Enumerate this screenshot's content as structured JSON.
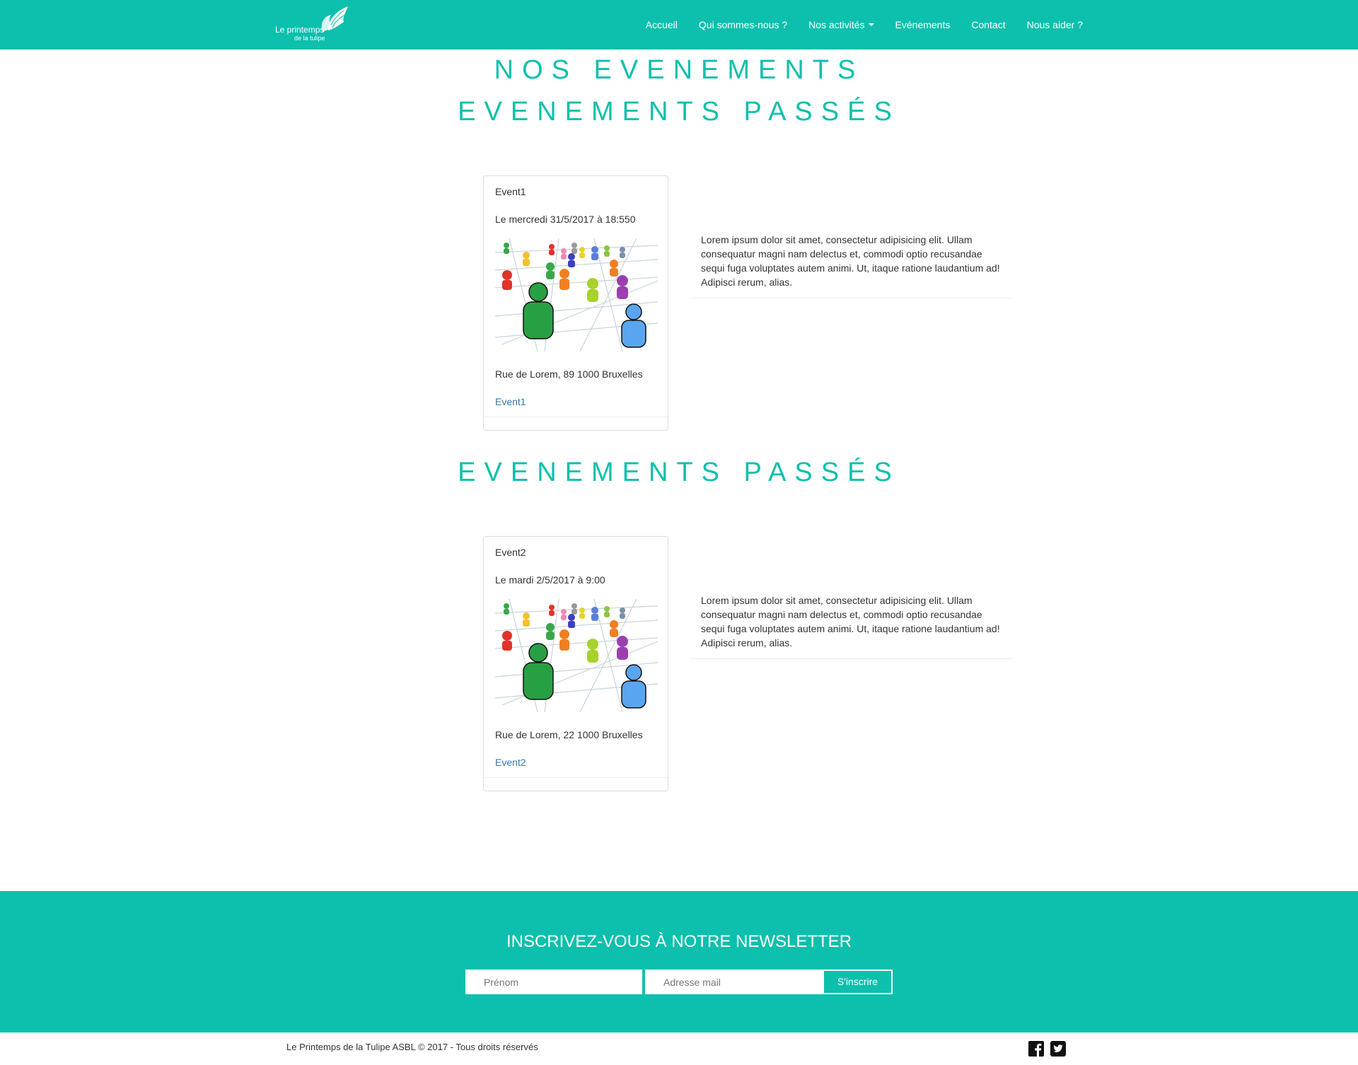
{
  "brand": {
    "line1": "Le printemps",
    "line2": "de la tulipe"
  },
  "nav": {
    "items": [
      {
        "label": "Accueil"
      },
      {
        "label": "Qui sommes-nous ?"
      },
      {
        "label": "Nos activités"
      },
      {
        "label": "Evénements"
      },
      {
        "label": "Contact"
      },
      {
        "label": "Nous aider ?"
      }
    ]
  },
  "page": {
    "title": "NOS EVENEMENTS",
    "sections": [
      {
        "heading": "EVENEMENTS PASSÉS",
        "event": {
          "title": "Event1",
          "date": "Le mercredi 31/5/2017 à 18:550",
          "address": "Rue de Lorem, 89 1000 Bruxelles",
          "link": "Event1",
          "description": "Lorem ipsum dolor sit amet, consectetur adipisicing elit. Ullam consequatur magni nam delectus et, commodi optio recusandae sequi fuga voluptates autem animi. Ut, itaque ratione laudantium ad! Adipisci rerum, alias."
        }
      },
      {
        "heading": "EVENEMENTS PASSÉS",
        "event": {
          "title": "Event2",
          "date": "Le mardi 2/5/2017 à 9:00",
          "address": "Rue de Lorem, 22 1000 Bruxelles",
          "link": "Event2",
          "description": "Lorem ipsum dolor sit amet, consectetur adipisicing elit. Ullam consequatur magni nam delectus et, commodi optio recusandae sequi fuga voluptates autem animi. Ut, itaque ratione laudantium ad! Adipisci rerum, alias."
        }
      }
    ]
  },
  "newsletter": {
    "title": "INSCRIVEZ-VOUS À NOTRE NEWSLETTER",
    "firstname_placeholder": "Prénom",
    "email_placeholder": "Adresse mail",
    "submit_label": "S'inscrire"
  },
  "footer": {
    "copyright": "Le Printemps de la Tulipe ASBL © 2017 - Tous droits réservés",
    "social": [
      "facebook-icon",
      "twitter-icon"
    ]
  },
  "colors": {
    "brand": "#0cc0ad",
    "link": "#337ab7"
  }
}
